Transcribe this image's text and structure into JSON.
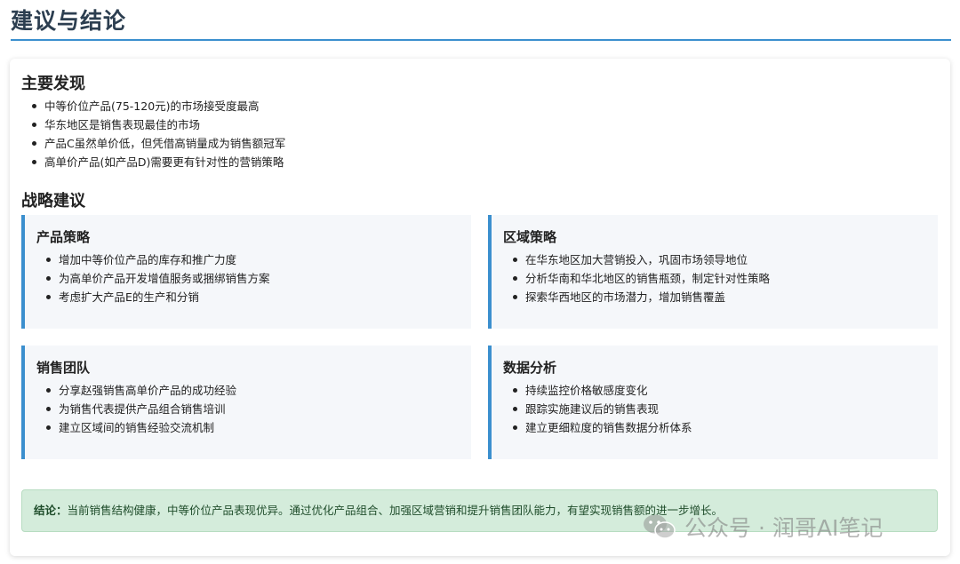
{
  "header": {
    "title": "建议与结论"
  },
  "findings": {
    "title": "主要发现",
    "items": [
      "中等价位产品(75-120元)的市场接受度最高",
      "华东地区是销售表现最佳的市场",
      "产品C虽然单价低，但凭借高销量成为销售额冠军",
      "高单价产品(如产品D)需要更有针对性的营销策略"
    ]
  },
  "strategy": {
    "title": "战略建议",
    "boxes": [
      {
        "title": "产品策略",
        "items": [
          "增加中等价位产品的库存和推广力度",
          "为高单价产品开发增值服务或捆绑销售方案",
          "考虑扩大产品E的生产和分销"
        ]
      },
      {
        "title": "区域策略",
        "items": [
          "在华东地区加大营销投入，巩固市场领导地位",
          "分析华南和华北地区的销售瓶颈，制定针对性策略",
          "探索华西地区的市场潜力，增加销售覆盖"
        ]
      },
      {
        "title": "销售团队",
        "items": [
          "分享赵强销售高单价产品的成功经验",
          "为销售代表提供产品组合销售培训",
          "建立区域间的销售经验交流机制"
        ]
      },
      {
        "title": "数据分析",
        "items": [
          "持续监控价格敏感度变化",
          "跟踪实施建议后的销售表现",
          "建立更细粒度的销售数据分析体系"
        ]
      }
    ]
  },
  "conclusion": {
    "label": "结论：",
    "text": "当前销售结构健康，中等价位产品表现优异。通过优化产品组合、加强区域营销和提升销售团队能力，有望实现销售额的进一步增长。"
  },
  "watermark": {
    "text": "公众号 · 润哥AI笔记",
    "icon": "wechat-icon"
  }
}
